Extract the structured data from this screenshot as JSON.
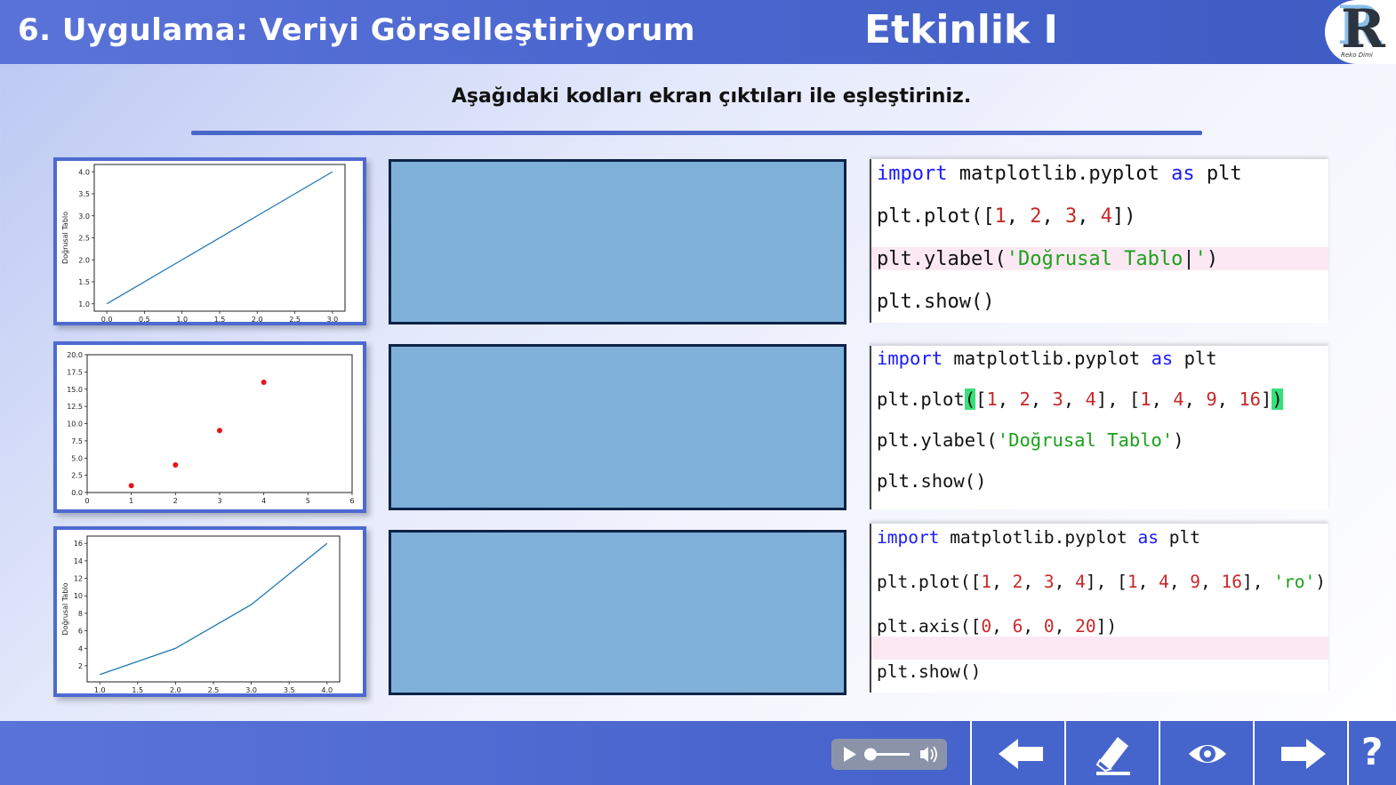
{
  "header": {
    "lesson_title": "6. Uygulama: Veriyi Görselleştiriyorum",
    "activity_title": "Etkinlik I",
    "logo_caption": "Reko Dimi"
  },
  "instruction": "Aşağıdaki kodları ekran çıktıları ile eşleştiriniz.",
  "rows": [
    {
      "thumb": {
        "ylabel": "Doğrusal Tablo",
        "yticks": [
          "4.0",
          "3.5",
          "3.0",
          "2.5",
          "2.0",
          "1.5",
          "1.0"
        ],
        "xticks": [
          "0.0",
          "0.5",
          "1.0",
          "1.5",
          "2.0",
          "2.5",
          "3.0"
        ]
      },
      "code": {
        "lines": [
          "import matplotlib.pyplot as plt",
          "plt.plot([1, 2, 3, 4])",
          "plt.ylabel('Doğrusal Tablo')",
          "plt.show()"
        ]
      }
    },
    {
      "thumb": {
        "ylabel": "",
        "yticks": [
          "20.0",
          "17.5",
          "15.0",
          "12.5",
          "10.0",
          "7.5",
          "5.0",
          "2.5",
          "0.0"
        ],
        "xticks": [
          "0",
          "1",
          "2",
          "3",
          "4",
          "5",
          "6"
        ]
      },
      "code": {
        "lines": [
          "import matplotlib.pyplot as plt",
          "plt.plot([1, 2, 3, 4], [1, 4, 9, 16])",
          "plt.ylabel('Doğrusal Tablo')",
          "plt.show()"
        ]
      }
    },
    {
      "thumb": {
        "ylabel": "Doğrusal Tablo",
        "yticks": [
          "16",
          "14",
          "12",
          "10",
          "8",
          "6",
          "4",
          "2"
        ],
        "xticks": [
          "1.0",
          "1.5",
          "2.0",
          "2.5",
          "3.0",
          "3.5",
          "4.0"
        ]
      },
      "code": {
        "lines": [
          "import matplotlib.pyplot as plt",
          "plt.plot([1, 2, 3, 4], [1, 4, 9, 16], 'ro')",
          "plt.axis([0, 6, 0, 20])",
          "plt.show()"
        ]
      }
    }
  ],
  "chart_data": [
    {
      "type": "line",
      "x": [
        0,
        1,
        2,
        3
      ],
      "series": [
        {
          "values": [
            1,
            2,
            3,
            4
          ]
        }
      ],
      "ylabel": "Doğrusal Tablo",
      "xlim": [
        0,
        3
      ],
      "ylim": [
        1,
        4
      ]
    },
    {
      "type": "scatter",
      "x": [
        1,
        2,
        3,
        4
      ],
      "series": [
        {
          "values": [
            1,
            4,
            9,
            16
          ]
        }
      ],
      "xlim": [
        0,
        6
      ],
      "ylim": [
        0,
        20
      ]
    },
    {
      "type": "line",
      "x": [
        1,
        2,
        3,
        4
      ],
      "series": [
        {
          "values": [
            1,
            4,
            9,
            16
          ]
        }
      ],
      "ylabel": "Doğrusal Tablo",
      "xlim": [
        1,
        4
      ],
      "ylim": [
        1,
        16
      ]
    }
  ],
  "controls": {
    "player_buttons": [
      "play",
      "volume"
    ],
    "nav_buttons": [
      "back",
      "erase",
      "show-answer",
      "next",
      "help"
    ],
    "help_label": "?"
  }
}
